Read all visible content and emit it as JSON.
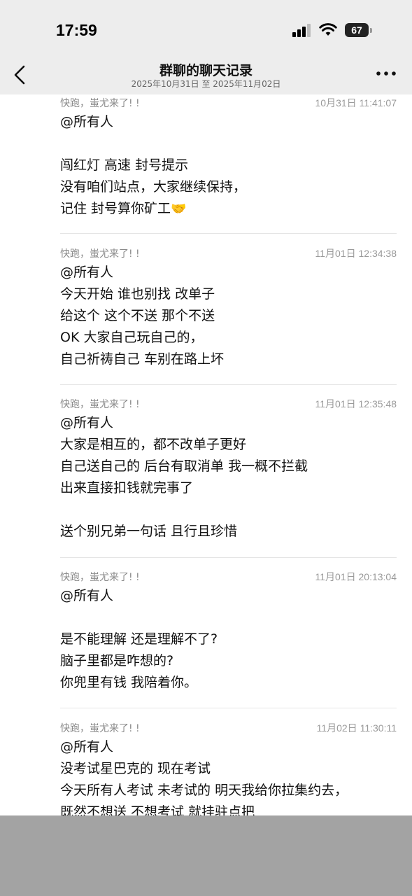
{
  "status": {
    "time": "17:59",
    "battery": "67"
  },
  "nav": {
    "title": "群聊的聊天记录",
    "subtitle": "2025年10月31日 至 2025年11月02日"
  },
  "messages": [
    {
      "sender": "快跑，蚩尤来了! !",
      "time": "10月31日 11:41:07",
      "lines": [
        "@所有人",
        "",
        "闯红灯 高速 封号提示",
        "没有咱们站点，大家继续保持，",
        "记住 封号算你矿工"
      ],
      "emoji": "handshake-emoji"
    },
    {
      "sender": "快跑，蚩尤来了! !",
      "time": "11月01日 12:34:38",
      "lines": [
        "@所有人",
        "今天开始 谁也别找 改单子",
        "给这个 这个不送 那个不送",
        "OK  大家自己玩自己的，",
        "自己祈祷自己 车别在路上坏"
      ]
    },
    {
      "sender": "快跑，蚩尤来了! !",
      "time": "11月01日 12:35:48",
      "lines": [
        "@所有人",
        "大家是相互的，都不改单子更好",
        "自己送自己的 后台有取消单 我一概不拦截",
        "出来直接扣钱就完事了",
        "",
        "送个别兄弟一句话  且行且珍惜"
      ]
    },
    {
      "sender": "快跑，蚩尤来了! !",
      "time": "11月01日 20:13:04",
      "lines": [
        "@所有人",
        "",
        "是不能理解 还是理解不了?",
        "脑子里都是咋想的?",
        "你兜里有钱 我陪着你。"
      ]
    },
    {
      "sender": "快跑，蚩尤来了! !",
      "time": "11月02日 11:30:11",
      "lines": [
        "@所有人",
        "没考试星巴克的 现在考试",
        "今天所有人考试  未考试的 明天我给你拉集约去，",
        "既然不想送 不想考试 就挂驻点把"
      ]
    }
  ],
  "colors": {
    "bar_bg": "#ededed",
    "overlay": "#a3a3a3"
  }
}
